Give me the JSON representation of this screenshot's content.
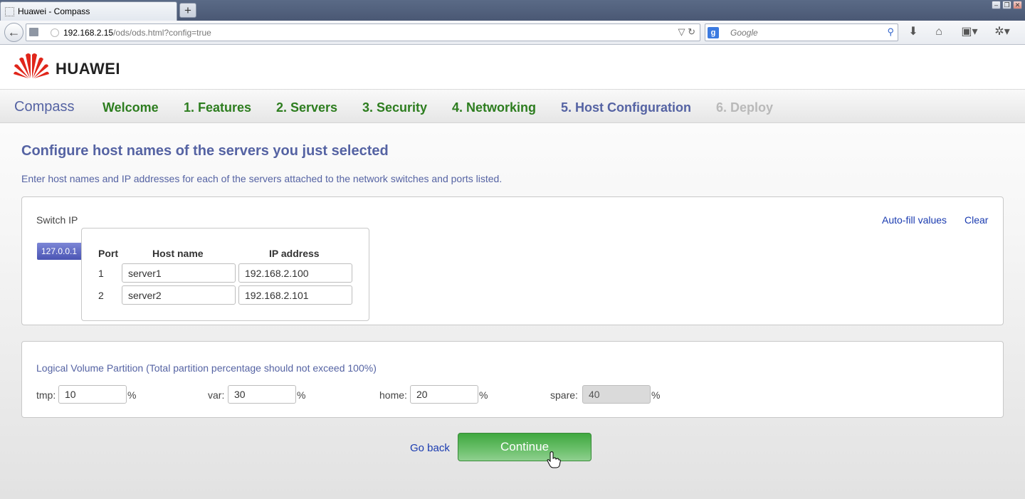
{
  "browser": {
    "tab_title": "Huawei - Compass",
    "new_tab": "+",
    "url_host": "192.168.2.15",
    "url_path": "/ods/ods.html?config=true",
    "search_engine": "g",
    "search_placeholder": "Google",
    "icons": [
      "back-arrow-icon",
      "download-icon",
      "home-icon",
      "bookmarks-icon",
      "addon-icon"
    ]
  },
  "header": {
    "logo_text": "HUAWEI",
    "logo_color": "#e0261b"
  },
  "nav": {
    "brand": "Compass",
    "steps": [
      {
        "label": "Welcome",
        "state": "done"
      },
      {
        "label": "1. Features",
        "state": "done"
      },
      {
        "label": "2. Servers",
        "state": "done"
      },
      {
        "label": "3. Security",
        "state": "done"
      },
      {
        "label": "4. Networking",
        "state": "done"
      },
      {
        "label": "5. Host Configuration",
        "state": "current"
      },
      {
        "label": "6. Deploy",
        "state": "disabled"
      }
    ]
  },
  "main": {
    "title": "Configure host names of the servers you just selected",
    "description": "Enter host names and IP addresses for each of the servers attached to the network switches and ports listed."
  },
  "switch_panel": {
    "switch_ip_label": "Switch IP",
    "autofill_label": "Auto-fill values",
    "clear_label": "Clear",
    "selected_switch": "127.0.0.1",
    "columns": [
      "Port",
      "Host name",
      "IP address"
    ],
    "rows": [
      {
        "port": "1",
        "host": "server1",
        "ip": "192.168.2.100"
      },
      {
        "port": "2",
        "host": "server2",
        "ip": "192.168.2.101"
      }
    ]
  },
  "partition": {
    "title": "Logical Volume Partition (Total partition percentage should not exceed 100%)",
    "percent_sign": "%",
    "fields": [
      {
        "label": "tmp:",
        "value": "10",
        "readonly": false
      },
      {
        "label": "var:",
        "value": "30",
        "readonly": false
      },
      {
        "label": "home:",
        "value": "20",
        "readonly": false
      },
      {
        "label": "spare:",
        "value": "40",
        "readonly": true
      }
    ]
  },
  "actions": {
    "go_back": "Go back",
    "continue": "Continue"
  },
  "colors": {
    "accent": "#5563a3",
    "done_step": "#2d7d1f",
    "disabled_step": "#b9b9b9",
    "link": "#1a3bb0",
    "continue_button": "#4caf50"
  }
}
